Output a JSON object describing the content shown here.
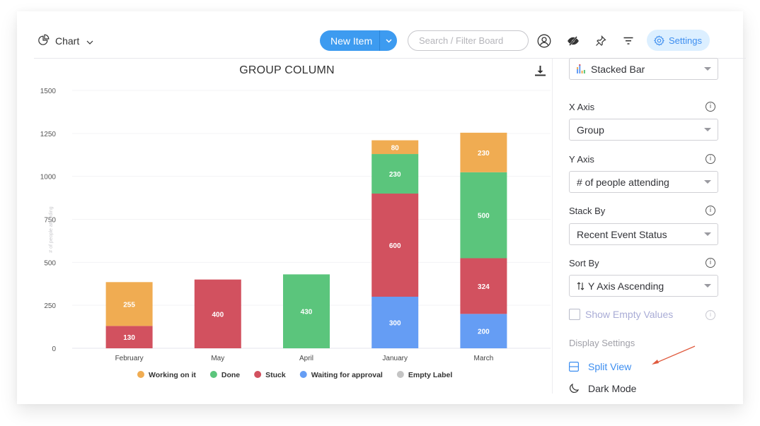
{
  "topbar": {
    "view_label": "Chart",
    "new_item_label": "New Item",
    "search_placeholder": "Search / Filter Board",
    "settings_label": "Settings",
    "icons": [
      "person-icon",
      "eye-off-icon",
      "pin-icon",
      "filter-icon",
      "gear-icon"
    ]
  },
  "colors": {
    "accent": "#3d9bf0",
    "working_on_it": "#f0ac52",
    "done": "#5bc57c",
    "stuck": "#d2515f",
    "waiting_for_approval": "#659df4",
    "empty_label": "#c4c4c4"
  },
  "chart_data": {
    "type": "bar",
    "stacked": true,
    "title": "GROUP COLUMN",
    "xlabel": "",
    "ylabel": "# of people attending",
    "ylim": [
      0,
      1500
    ],
    "yticks": [
      0,
      250,
      500,
      750,
      1000,
      1250,
      1500
    ],
    "grid": true,
    "legend_position": "bottom",
    "categories": [
      "February",
      "May",
      "April",
      "January",
      "March"
    ],
    "series": [
      {
        "name": "Waiting for approval",
        "color": "#659df4",
        "values": [
          0,
          0,
          0,
          300,
          200
        ]
      },
      {
        "name": "Stuck",
        "color": "#d2515f",
        "values": [
          130,
          400,
          0,
          600,
          324
        ]
      },
      {
        "name": "Done",
        "color": "#5bc57c",
        "values": [
          0,
          0,
          430,
          230,
          500
        ]
      },
      {
        "name": "Working on it",
        "color": "#f0ac52",
        "values": [
          255,
          0,
          0,
          80,
          230
        ]
      }
    ],
    "legend": [
      {
        "name": "Working on it",
        "color": "#f0ac52"
      },
      {
        "name": "Done",
        "color": "#5bc57c"
      },
      {
        "name": "Stuck",
        "color": "#d2515f"
      },
      {
        "name": "Waiting for approval",
        "color": "#659df4"
      },
      {
        "name": "Empty Label",
        "color": "#c4c4c4"
      }
    ]
  },
  "panel": {
    "chart_type": "Stacked Bar",
    "x_axis_label": "X Axis",
    "x_axis_value": "Group",
    "y_axis_label": "Y Axis",
    "y_axis_value": "# of people attending",
    "stack_by_label": "Stack By",
    "stack_by_value": "Recent Event Status",
    "sort_by_label": "Sort By",
    "sort_by_value": "Y Axis Ascending",
    "show_empty_label": "Show Empty Values",
    "show_empty_checked": false,
    "display_settings_label": "Display Settings",
    "split_view_label": "Split View",
    "dark_mode_label": "Dark Mode",
    "info_glyph": "i"
  }
}
